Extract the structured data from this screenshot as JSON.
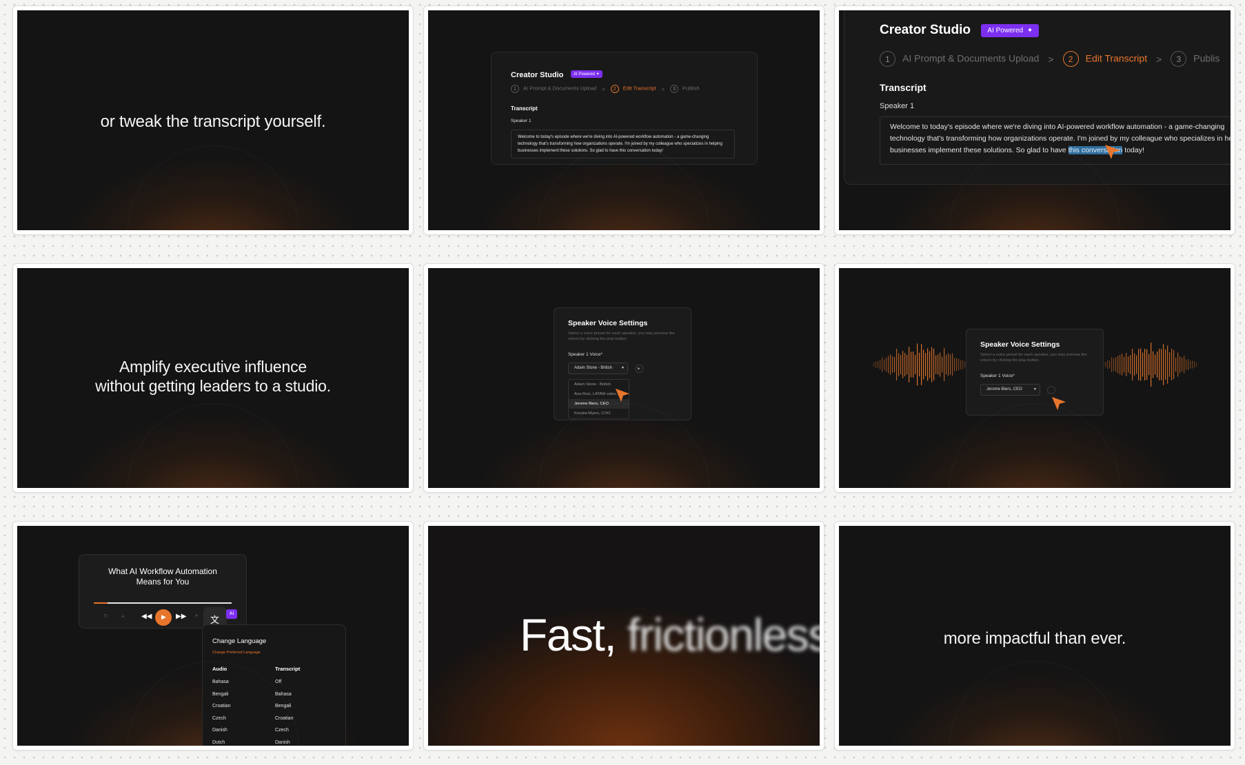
{
  "slides": {
    "s1": {
      "text": "or tweak the transcript yourself."
    },
    "s2": {
      "title": "Creator Studio",
      "badge": "AI Powered",
      "steps": [
        {
          "num": "1",
          "label": "AI Prompt & Documents Upload"
        },
        {
          "num": "2",
          "label": "Edit Transcript"
        },
        {
          "num": "3",
          "label": "Publish"
        }
      ],
      "section": "Transcript",
      "speaker": "Speaker 1",
      "body": "Welcome to today's episode where we're diving into AI-powered workflow automation - a game-changing technology that's transforming how organizations operate. I'm joined by my colleague who specializes in helping businesses implement these solutions. So glad to have this conversation today!"
    },
    "s3": {
      "title": "Creator Studio",
      "badge": "AI Powered",
      "steps": [
        {
          "num": "1",
          "label": "AI Prompt & Documents Upload"
        },
        {
          "num": "2",
          "label": "Edit Transcript"
        },
        {
          "num": "3",
          "label": "Publis"
        }
      ],
      "section": "Transcript",
      "speaker": "Speaker 1",
      "body_before": "Welcome to today's episode where we're diving into AI-powered workflow automation - a game-changing technology that's transforming how organizations operate. I'm joined by my colleague who specializes in helping businesses implement these solutions. So glad to have ",
      "body_highlight": "this conversation",
      "body_after": " today!"
    },
    "s4": {
      "line1": "Amplify executive influence",
      "line2": "without getting leaders to a studio."
    },
    "s5": {
      "title": "Speaker Voice Settings",
      "desc": "Select a voice preset for each speaker, you may preview the voices by clicking the play button.",
      "field_label": "Speaker 1 Voice*",
      "selected": "Adam Stone - British",
      "options": [
        "Adam Stone - British",
        "Ana Ruiz, LATAM sales...",
        "Jerome Biers, CEO",
        "Kendra Myers, COO"
      ]
    },
    "s6": {
      "title": "Speaker Voice Settings",
      "desc": "Select a voice preset for each speaker, you may preview the voices by clicking the play button.",
      "field_label": "Speaker 1 Voice*",
      "selected": "Jerome Biers, CEO"
    },
    "s7": {
      "player_title": "What AI Workflow Automation Means for You",
      "tt_label": "Tt",
      "ai_label": "AI",
      "lang_title": "Change Language",
      "lang_sub": "Change Preferred Language",
      "audio_header": "Audio",
      "transcript_header": "Transcript",
      "audio": [
        "Bahasa",
        "Bengali",
        "Croatian",
        "Czech",
        "Danish",
        "Dutch"
      ],
      "transcript": [
        "Off",
        "Bahasa",
        "Bengali",
        "Croatian",
        "Czech",
        "Danish"
      ]
    },
    "s8": {
      "word1": "Fast,",
      "word2": "frictionless"
    },
    "s9": {
      "text": "more impactful than ever."
    }
  },
  "colors": {
    "accent": "#e8752c",
    "badge": "#7c2ff0",
    "highlight": "#2f6d9c",
    "slide_bg": "#141414"
  }
}
